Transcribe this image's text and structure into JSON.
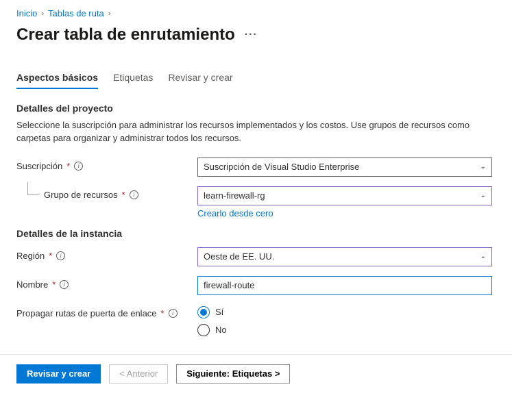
{
  "breadcrumb": {
    "home": "Inicio",
    "routeTables": "Tablas de ruta"
  },
  "pageTitle": "Crear tabla de enrutamiento",
  "tabs": {
    "basics": "Aspectos básicos",
    "tags": "Etiquetas",
    "review": "Revisar y crear"
  },
  "project": {
    "heading": "Detalles del proyecto",
    "description": "Seleccione la suscripción para administrar los recursos implementados y los costos. Use grupos de recursos como carpetas para organizar y administrar todos los recursos.",
    "subscription": {
      "label": "Suscripción",
      "value": "Suscripción de Visual Studio Enterprise"
    },
    "resourceGroup": {
      "label": "Grupo de recursos",
      "value": "learn-firewall-rg",
      "createNew": "Crearlo desde cero"
    }
  },
  "instance": {
    "heading": "Detalles de la instancia",
    "region": {
      "label": "Región",
      "value": "Oeste de EE. UU."
    },
    "name": {
      "label": "Nombre",
      "value": "firewall-route"
    },
    "propagate": {
      "label": "Propagar rutas de puerta de enlace",
      "yes": "Sí",
      "no": "No"
    }
  },
  "footer": {
    "reviewCreate": "Revisar y crear",
    "previous": "< Anterior",
    "next": "Siguiente: Etiquetas >"
  }
}
